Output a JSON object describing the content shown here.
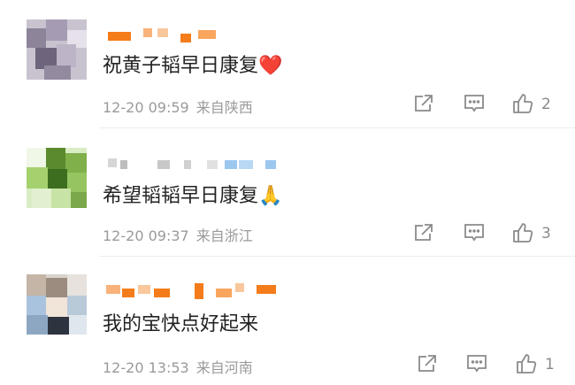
{
  "comments": [
    {
      "text": "祝黄子韬早日康复❤️",
      "time": "12-20 09:59",
      "location": "来自陕西",
      "likes": "2"
    },
    {
      "text": "希望韬韬早日康复🙏",
      "time": "12-20 09:37",
      "location": "来自浙江",
      "likes": "3"
    },
    {
      "text": "我的宝快点好起来",
      "time": "12-20 13:53",
      "location": "来自河南",
      "likes": "1"
    }
  ],
  "icons": {
    "share": "share-icon",
    "comment": "comment-icon",
    "like": "thumbs-up-icon"
  },
  "colors": {
    "text": "#222222",
    "meta": "#9a9a9a",
    "icon": "#8a8a8a",
    "accent": "#f47c1b"
  }
}
